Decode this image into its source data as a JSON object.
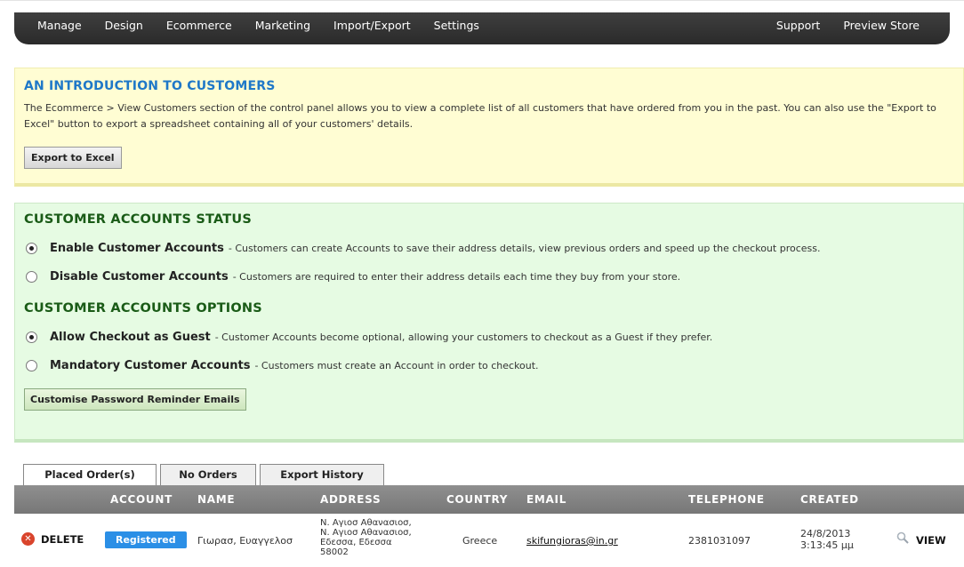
{
  "nav": {
    "left": [
      "Manage",
      "Design",
      "Ecommerce",
      "Marketing",
      "Import/Export",
      "Settings"
    ],
    "right": [
      "Support",
      "Preview Store"
    ]
  },
  "intro": {
    "title": "AN INTRODUCTION TO CUSTOMERS",
    "text": "The Ecommerce > View Customers section of the control panel allows you to view a complete list of all customers that have ordered from you in the past. You can also use the \"Export to Excel\" button to export a spreadsheet containing all of your customers' details.",
    "export_button": "Export to Excel"
  },
  "status": {
    "title": "CUSTOMER ACCOUNTS STATUS",
    "options": [
      {
        "label": "Enable Customer Accounts",
        "desc": "- Customers can create Accounts to save their address details, view previous orders and speed up the checkout process.",
        "selected": true
      },
      {
        "label": "Disable Customer Accounts",
        "desc": "- Customers are required to enter their address details each time they buy from your store.",
        "selected": false
      }
    ]
  },
  "options": {
    "title": "CUSTOMER ACCOUNTS OPTIONS",
    "options": [
      {
        "label": "Allow Checkout as Guest",
        "desc": "- Customer Accounts become optional, allowing your customers to checkout as a Guest if they prefer.",
        "selected": true
      },
      {
        "label": "Mandatory Customer Accounts",
        "desc": "- Customers must create an Account in order to checkout.",
        "selected": false
      }
    ],
    "reminder_button": "Customise Password Reminder Emails"
  },
  "tabs": [
    "Placed Order(s)",
    "No Orders",
    "Export History"
  ],
  "table": {
    "headers": [
      "ACCOUNT",
      "NAME",
      "ADDRESS",
      "COUNTRY",
      "EMAIL",
      "TELEPHONE",
      "CREATED"
    ],
    "row": {
      "delete": "DELETE",
      "account": "Registered",
      "name": "Γιωρασ, Ευαγγελοσ",
      "address": [
        "Ν. Αγιοσ Αθανασιοσ,",
        "Ν. Αγιοσ Αθανασιοσ,",
        "Εδεσσα, Εδεσσα",
        "58002"
      ],
      "country": "Greece",
      "email": "skifungioras@in.gr",
      "telephone": "2381031097",
      "created": [
        "24/8/2013",
        "3:13:45 μμ"
      ],
      "view": "VIEW"
    }
  },
  "colors": {
    "intro_title": "#1f78c8",
    "accounts_title": "#1a5b17",
    "registered_badge": "#2b8fe6",
    "delete_icon": "#d9442c"
  }
}
